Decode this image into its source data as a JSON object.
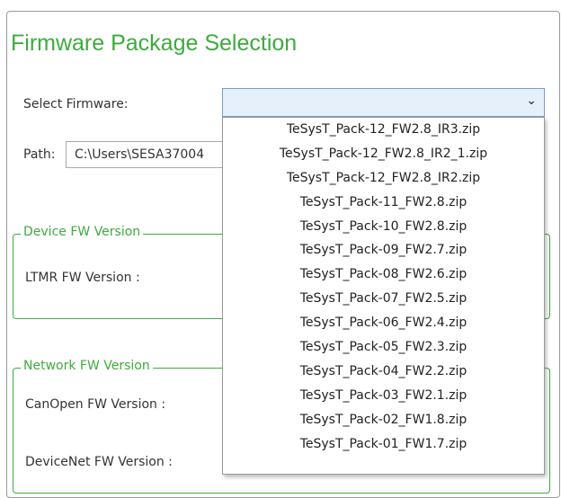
{
  "title": "Firmware Package Selection",
  "select_firmware": {
    "label": "Select Firmware:",
    "selected_value": "",
    "options": [
      "TeSysT_Pack-12_FW2.8_IR3.zip",
      "TeSysT_Pack-12_FW2.8_IR2_1.zip",
      "TeSysT_Pack-12_FW2.8_IR2.zip",
      "TeSysT_Pack-11_FW2.8.zip",
      "TeSysT_Pack-10_FW2.8.zip",
      "TeSysT_Pack-09_FW2.7.zip",
      "TeSysT_Pack-08_FW2.6.zip",
      "TeSysT_Pack-07_FW2.5.zip",
      "TeSysT_Pack-06_FW2.4.zip",
      "TeSysT_Pack-05_FW2.3.zip",
      "TeSysT_Pack-04_FW2.2.zip",
      "TeSysT_Pack-03_FW2.1.zip",
      "TeSysT_Pack-02_FW1.8.zip",
      "TeSysT_Pack-01_FW1.7.zip"
    ]
  },
  "path": {
    "label": "Path:",
    "value": "C:\\Users\\SESA37004"
  },
  "device_fw": {
    "legend": "Device FW Version",
    "ltmr_label": "LTMR FW Version :"
  },
  "network_fw": {
    "legend": "Network FW Version",
    "canopen_label": "CanOpen FW Version :",
    "devicenet_label": "DeviceNet FW Version :"
  },
  "colors": {
    "accent_green": "#3dab3d",
    "select_bg": "#e6f0fb",
    "select_border": "#7a9bc8"
  },
  "icons": {
    "dropdown": "chevron-down-icon"
  }
}
